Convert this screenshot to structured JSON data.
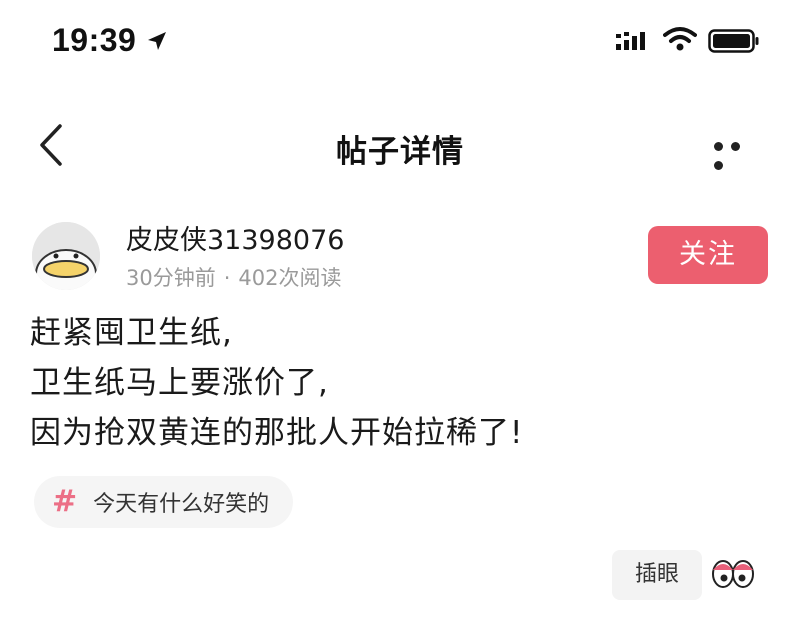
{
  "status_bar": {
    "time": "19:39",
    "icons": [
      "location-arrow-icon",
      "signal-icon",
      "wifi-icon",
      "battery-icon"
    ]
  },
  "nav": {
    "title": "帖子详情",
    "back_icon": "chevron-left-icon",
    "more_icon": "more-dots-icon"
  },
  "post": {
    "author": "皮皮侠31398076",
    "time_ago": "30分钟前",
    "separator": "·",
    "reads": "402次阅读",
    "follow_label": "关注",
    "lines": [
      "赶紧囤卫生纸,",
      "卫生纸马上要涨价了,",
      "因为抢双黄连的那批人开始拉稀了!"
    ],
    "topic": {
      "icon": "#",
      "label": "今天有什么好笑的"
    }
  },
  "footer": {
    "chip_label": "插眼",
    "reaction_icon": "eyes-icon"
  },
  "colors": {
    "accent": "#ec5f6f",
    "topic_hash": "#ec6f86",
    "meta_text": "#9a9a9a"
  }
}
